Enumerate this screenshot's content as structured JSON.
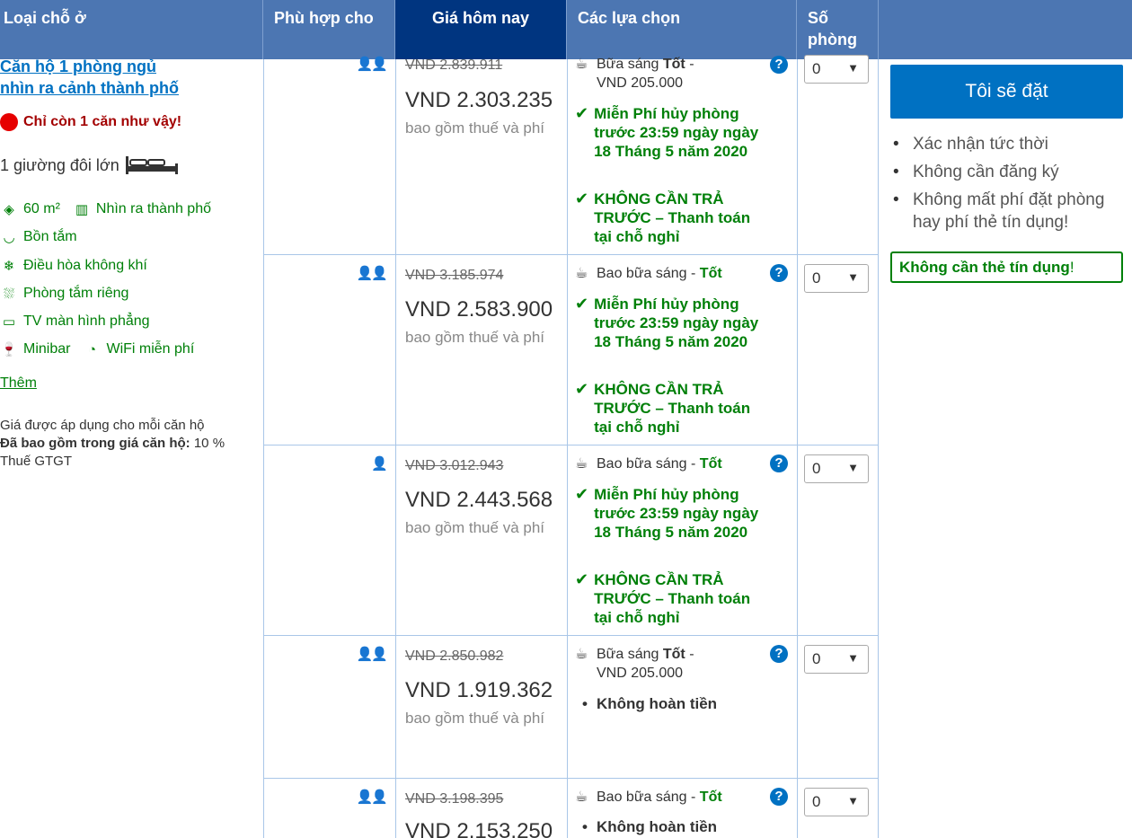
{
  "header": {
    "col_type": "Loại chỗ ở",
    "col_fit": "Phù hợp cho",
    "col_today": "Giá hôm nay",
    "col_options": "Các lựa chọn",
    "col_rooms": "Số phòng"
  },
  "room": {
    "name_line1": "Căn hộ 1 phòng ngủ",
    "name_line2": "nhìn ra cảnh thành phố",
    "scarcity": "Chỉ còn 1 căn như vậy!",
    "bed": "1 giường đôi lớn",
    "facilities": {
      "area": "60 m²",
      "view": "Nhìn ra thành phố",
      "bathtub": "Bồn tắm",
      "aircon": "Điều hòa không khí",
      "bathroom": "Phòng tắm riêng",
      "tv": "TV màn hình phẳng",
      "minibar": "Minibar",
      "wifi": "WiFi miễn phí"
    },
    "more": "Thêm",
    "note_line1": "Giá được áp dụng cho mỗi căn hộ",
    "note_included_label": "Đã bao gồm trong giá căn hộ:",
    "note_vat": "10 %",
    "note_vat_line2": "Thuế GTGT"
  },
  "rows": [
    {
      "persons": "👤👤",
      "old_price": "VND 2.839.911",
      "price": "VND 2.303.235",
      "tax": "bao gồm thuế và phí",
      "meal_prefix": "Bữa sáng",
      "meal_rating": "Tốt",
      "meal_suffix": "-",
      "meal_price": "VND 205.000",
      "cancel": "Miễn Phí hủy phòng trước 23:59 ngày ngày 18 Tháng 5 năm 2020",
      "prepay": "KHÔNG CẦN TRẢ TRƯỚC – Thanh toán tại chỗ nghỉ",
      "qty": "0"
    },
    {
      "persons": "👤👤",
      "old_price": "VND 3.185.974",
      "price": "VND 2.583.900",
      "tax": "bao gồm thuế và phí",
      "meal_prefix": "Bao bữa sáng -",
      "meal_rating": "Tốt",
      "cancel": "Miễn Phí hủy phòng trước 23:59 ngày ngày 18 Tháng 5 năm 2020",
      "prepay": "KHÔNG CẦN TRẢ TRƯỚC – Thanh toán tại chỗ nghỉ",
      "qty": "0"
    },
    {
      "persons": "👤",
      "old_price": "VND 3.012.943",
      "price": "VND 2.443.568",
      "tax": "bao gồm thuế và phí",
      "meal_prefix": "Bao bữa sáng -",
      "meal_rating": "Tốt",
      "cancel": "Miễn Phí hủy phòng trước 23:59 ngày ngày 18 Tháng 5 năm 2020",
      "prepay": "KHÔNG CẦN TRẢ TRƯỚC – Thanh toán tại chỗ nghỉ",
      "qty": "0"
    },
    {
      "persons": "👤👤",
      "old_price": "VND 2.850.982",
      "price": "VND 1.919.362",
      "tax": "bao gồm thuế và phí",
      "meal_prefix": "Bữa sáng",
      "meal_rating": "Tốt",
      "meal_suffix": "-",
      "meal_price": "VND 205.000",
      "policy": "Không hoàn tiền",
      "qty": "0"
    },
    {
      "persons": "👤👤",
      "old_price": "VND 3.198.395",
      "price": "VND 2.153.250",
      "meal_prefix": "Bao bữa sáng -",
      "meal_rating": "Tốt",
      "policy": "Không hoàn tiền",
      "qty": "0"
    }
  ],
  "sidebar": {
    "book_button": "Tôi sẽ đặt",
    "perks": [
      "Xác nhận tức thời",
      "Không cần đăng ký",
      "Không mất phí đặt phòng hay phí thẻ tín dụng!"
    ],
    "no_card": "Không cần thẻ tín dụng",
    "no_card_suffix": "!"
  },
  "colors": {
    "header_bg": "#4c76b2",
    "today_bg": "#003580",
    "link": "#0071c2",
    "green": "#008009",
    "scarcity": "#a30000"
  }
}
